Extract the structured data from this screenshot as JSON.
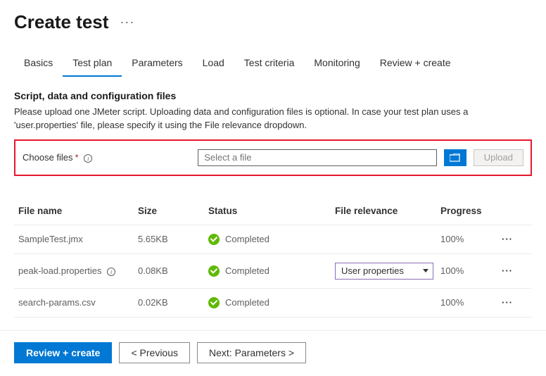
{
  "header": {
    "title": "Create test"
  },
  "tabs": [
    {
      "label": "Basics"
    },
    {
      "label": "Test plan",
      "active": true
    },
    {
      "label": "Parameters"
    },
    {
      "label": "Load"
    },
    {
      "label": "Test criteria"
    },
    {
      "label": "Monitoring"
    },
    {
      "label": "Review + create"
    }
  ],
  "section": {
    "title": "Script, data and configuration files",
    "desc": "Please upload one JMeter script. Uploading data and configuration files is optional. In case your test plan uses a 'user.properties' file, please specify it using the File relevance dropdown."
  },
  "filepicker": {
    "label": "Choose files",
    "placeholder": "Select a file",
    "upload_label": "Upload"
  },
  "table": {
    "headers": {
      "name": "File name",
      "size": "Size",
      "status": "Status",
      "relevance": "File relevance",
      "progress": "Progress"
    },
    "rows": [
      {
        "name": "SampleTest.jmx",
        "size": "5.65KB",
        "status": "Completed",
        "relevance": "",
        "progress": "100%",
        "info": false
      },
      {
        "name": "peak-load.properties",
        "size": "0.08KB",
        "status": "Completed",
        "relevance": "User properties",
        "progress": "100%",
        "info": true
      },
      {
        "name": "search-params.csv",
        "size": "0.02KB",
        "status": "Completed",
        "relevance": "",
        "progress": "100%",
        "info": false
      }
    ]
  },
  "footer": {
    "primary": "Review + create",
    "prev": "< Previous",
    "next": "Next: Parameters >"
  }
}
